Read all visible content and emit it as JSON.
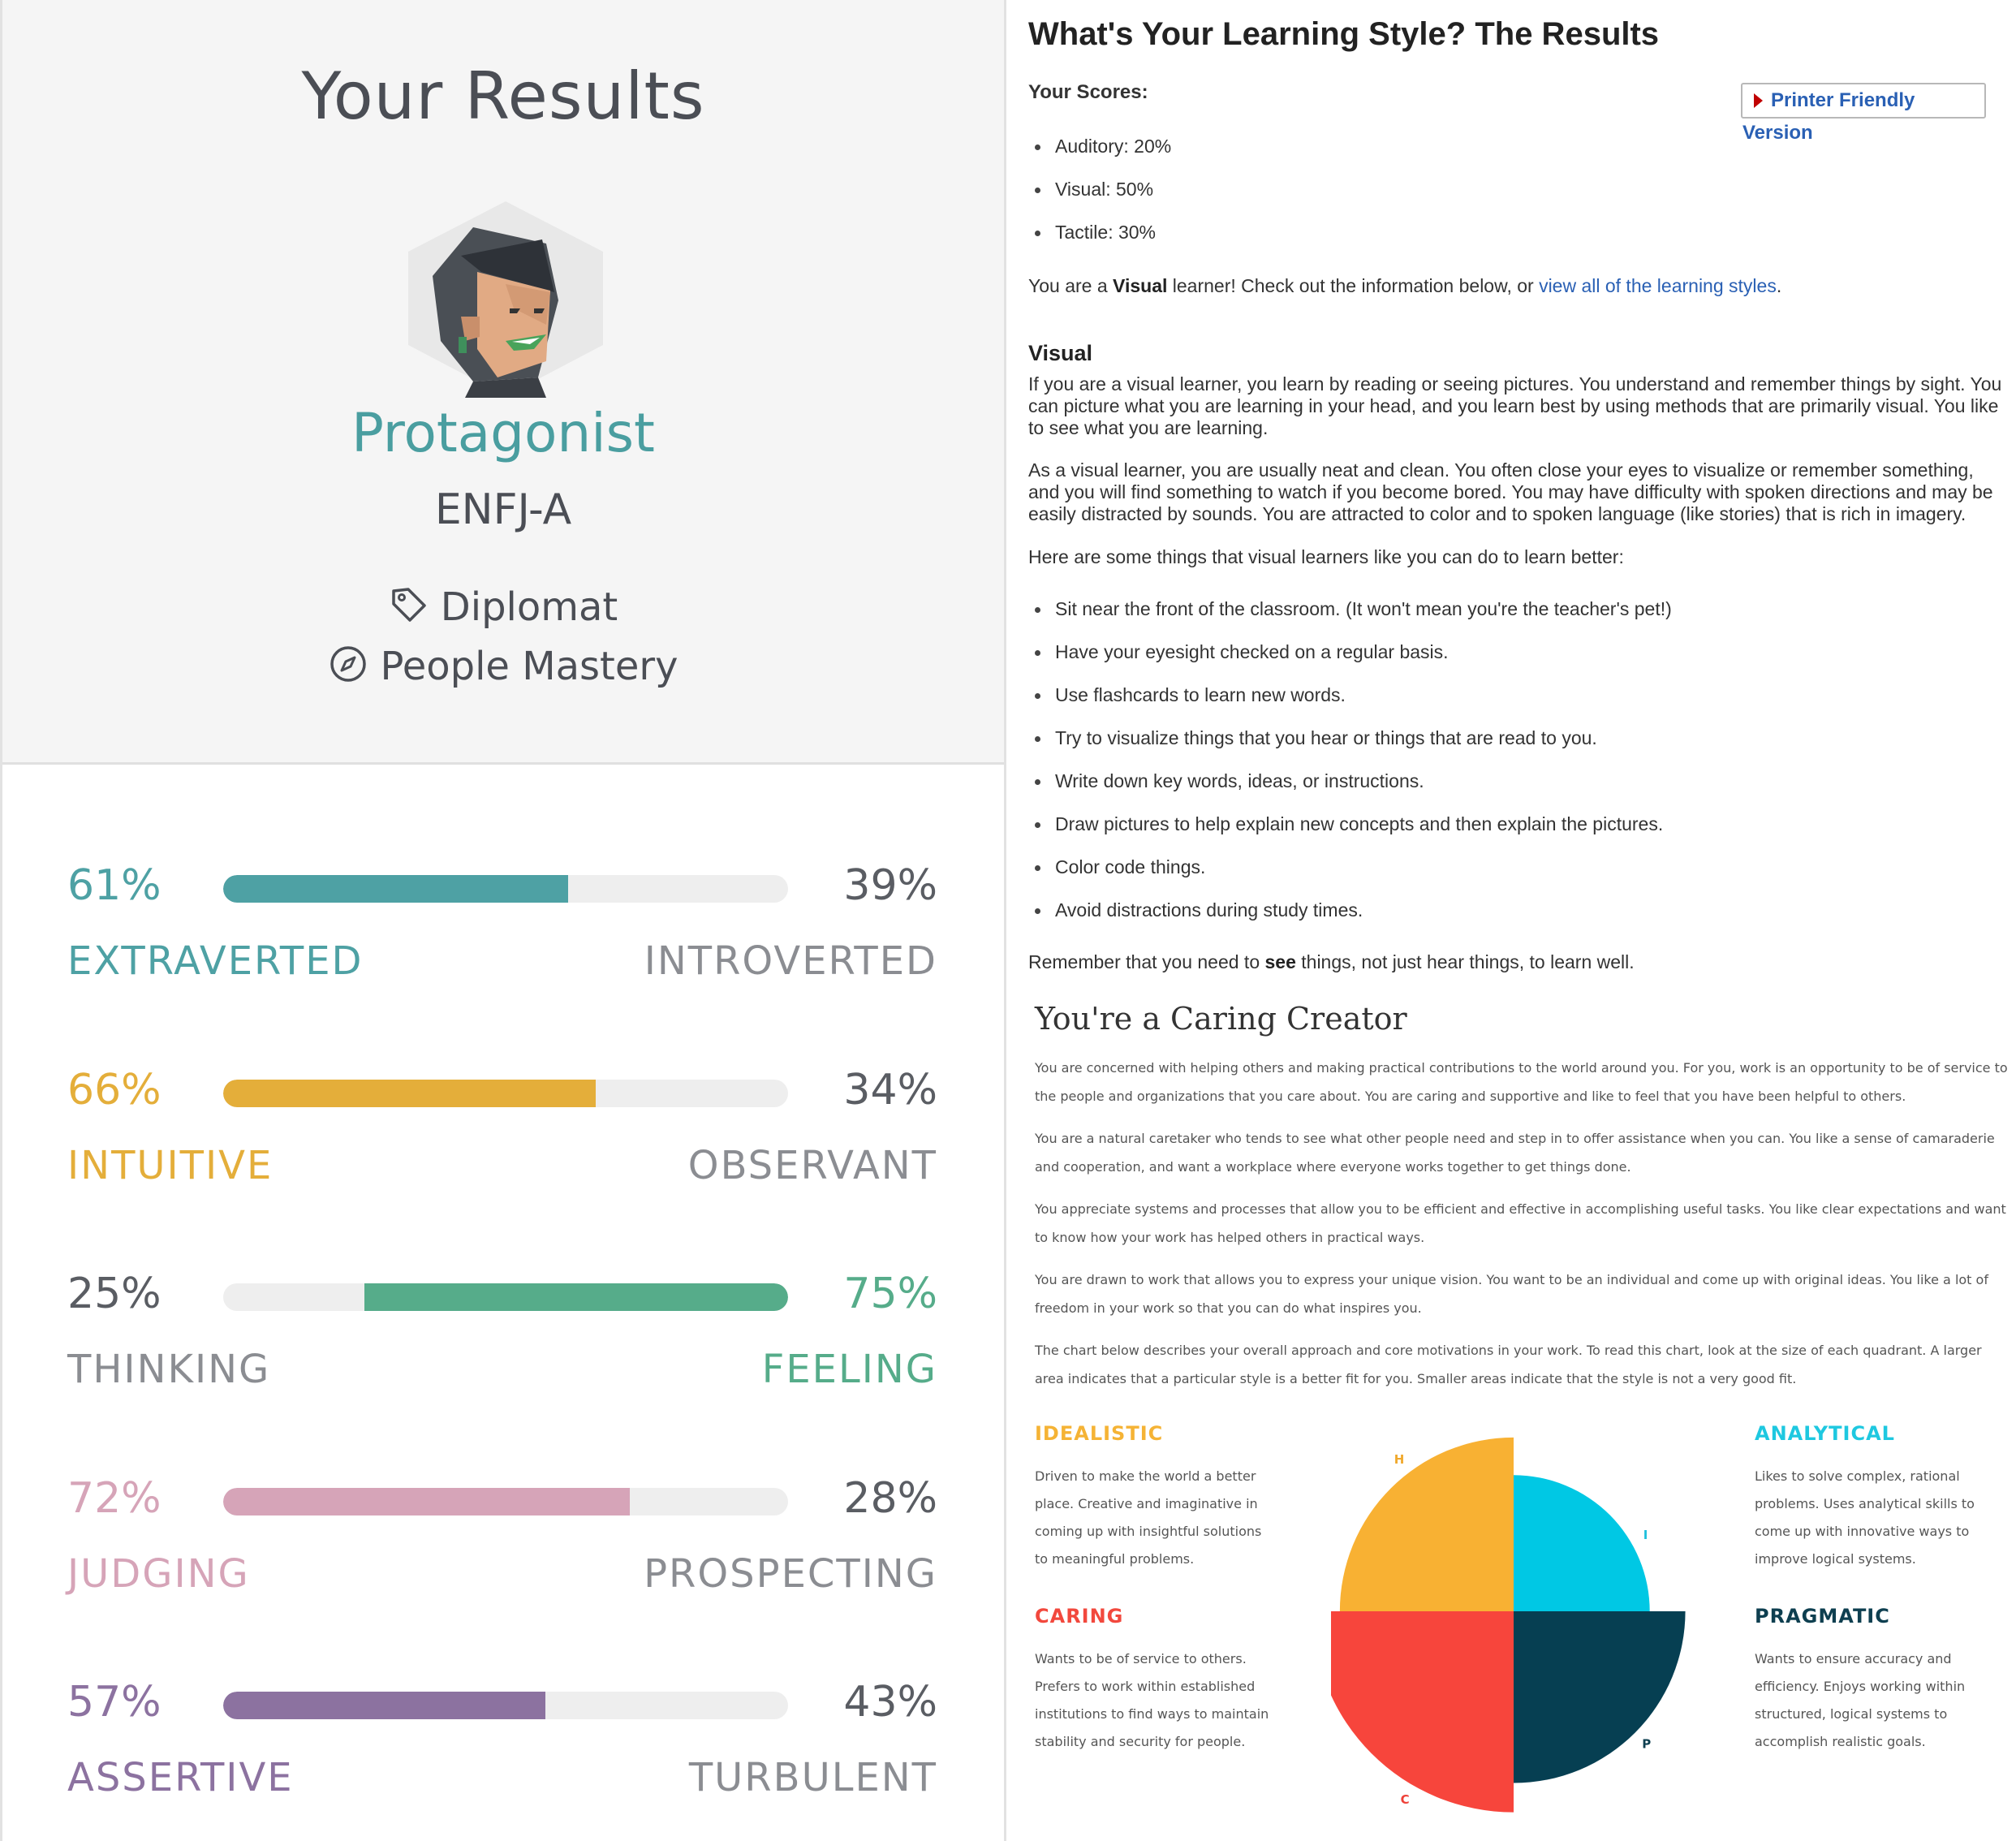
{
  "personality": {
    "title": "Your Results",
    "type_name": "Protagonist",
    "type_code": "ENFJ-A",
    "role": "Diplomat",
    "strategy": "People Mastery",
    "role_icon": "tag-icon",
    "strategy_icon": "compass-icon",
    "traits": [
      {
        "left_pct": "61%",
        "right_pct": "39%",
        "left_label": "EXTRAVERTED",
        "right_label": "INTROVERTED",
        "fill": 0.61,
        "fill_side": "left",
        "color": "#4ea1a4",
        "highlight": "left"
      },
      {
        "left_pct": "66%",
        "right_pct": "34%",
        "left_label": "INTUITIVE",
        "right_label": "OBSERVANT",
        "fill": 0.66,
        "fill_side": "left",
        "color": "#e4ae3a",
        "highlight": "left"
      },
      {
        "left_pct": "25%",
        "right_pct": "75%",
        "left_label": "THINKING",
        "right_label": "FEELING",
        "fill": 0.75,
        "fill_side": "right",
        "color": "#56ac8a",
        "highlight": "right"
      },
      {
        "left_pct": "72%",
        "right_pct": "28%",
        "left_label": "JUDGING",
        "right_label": "PROSPECTING",
        "fill": 0.72,
        "fill_side": "left",
        "color": "#d6a4b8",
        "highlight": "left"
      },
      {
        "left_pct": "57%",
        "right_pct": "43%",
        "left_label": "ASSERTIVE",
        "right_label": "TURBULENT",
        "fill": 0.57,
        "fill_side": "left",
        "color": "#8c72a0",
        "highlight": "left"
      }
    ],
    "muted_color": "#5a5d63"
  },
  "learning_style": {
    "title": "What's Your Learning Style? The Results",
    "scores_label": "Your Scores:",
    "printer_button": "Printer Friendly Version",
    "scores": [
      "Auditory: 20%",
      "Visual: 50%",
      "Tactile: 30%"
    ],
    "result_prefix": "You are a ",
    "result_style": "Visual",
    "result_suffix": " learner! Check out the information below, or ",
    "result_link": "view all of the learning styles",
    "result_end": ".",
    "section_heading": "Visual",
    "paragraph1": "If you are a visual learner, you learn by reading or seeing pictures. You understand and remember things by sight. You can picture what you are learning in your head, and you learn best by using methods that are primarily visual. You like to see what you are learning.",
    "paragraph2": "As a visual learner, you are usually neat and clean. You often close your eyes to visualize or remember something, and you will find something to watch if you become bored. You may have difficulty with spoken directions and may be easily distracted by sounds. You are attracted to color and to spoken language (like stories) that is rich in imagery.",
    "tips_intro": "Here are some things that visual learners like you can do to learn better:",
    "tips": [
      "Sit near the front of the classroom. (It won't mean you're the teacher's pet!)",
      "Have your eyesight checked on a regular basis.",
      "Use flashcards to learn new words.",
      "Try to visualize things that you hear or things that are read to you.",
      "Write down key words, ideas, or instructions.",
      "Draw pictures to help explain new concepts and then explain the pictures.",
      "Color code things.",
      "Avoid distractions during study times."
    ],
    "closing_prefix": "Remember that you need to ",
    "closing_bold": "see",
    "closing_suffix": " things, not just hear things, to learn well."
  },
  "career": {
    "title": "You're a Caring Creator",
    "paragraphs": [
      "You are concerned with helping others and making practical contributions to the world around you. For you, work is an opportunity to be of service to the people and organizations that you care about. You are caring and supportive and like to feel that you have been helpful to others.",
      "You are a natural caretaker who tends to see what other people need and step in to offer assistance when you can. You like a sense of camaraderie and cooperation, and want a workplace where everyone works together to get things done.",
      "You appreciate systems and processes that allow you to be efficient and effective in accomplishing useful tasks. You like clear expectations and want to know how your work has helped others in practical ways.",
      "You are drawn to work that allows you to express your unique vision. You want to be an individual and come up with original ideas. You like a lot of freedom in your work so that you can do what inspires you.",
      "The chart below describes your overall approach and core motivations in your work. To read this chart, look at the size of each quadrant. A larger area indicates that a particular style is a better fit for you. Smaller areas indicate that the style is not a very good fit."
    ],
    "quadrants": {
      "idealistic": {
        "heading": "IDEALISTIC",
        "color": "#f5b335",
        "desc": "Driven to make the world a better place. Creative and imaginative in coming up with insightful solutions to meaningful problems."
      },
      "analytical": {
        "heading": "ANALYTICAL",
        "color": "#1ec8e0",
        "desc": "Likes to solve complex, rational problems. Uses analytical skills to come up with innovative ways to improve logical systems."
      },
      "caring": {
        "heading": "CARING",
        "color": "#f2483d",
        "desc": "Wants to be of service to others. Prefers to work within established institutions to find ways to maintain stability and security for people."
      },
      "pragmatic": {
        "heading": "PRAGMATIC",
        "color": "#0e3f50",
        "desc": "Wants to ensure accuracy and efficiency. Enjoys working within structured, logical systems to accomplish realistic goals."
      }
    }
  },
  "chart_data": {
    "type": "pie",
    "subtype": "polar-quadrant",
    "categories": [
      "H",
      "I",
      "P",
      "C"
    ],
    "values": [
      0.83,
      0.65,
      0.82,
      0.96
    ],
    "value_scale": "relative radius, largest quadrant = 1",
    "colors": [
      "#f8b133",
      "#00c8e4",
      "#063f52",
      "#f7453c"
    ],
    "label_colors": [
      "#f0a92d",
      "#1ec0dc",
      "#0e3f50",
      "#ee4038"
    ]
  }
}
